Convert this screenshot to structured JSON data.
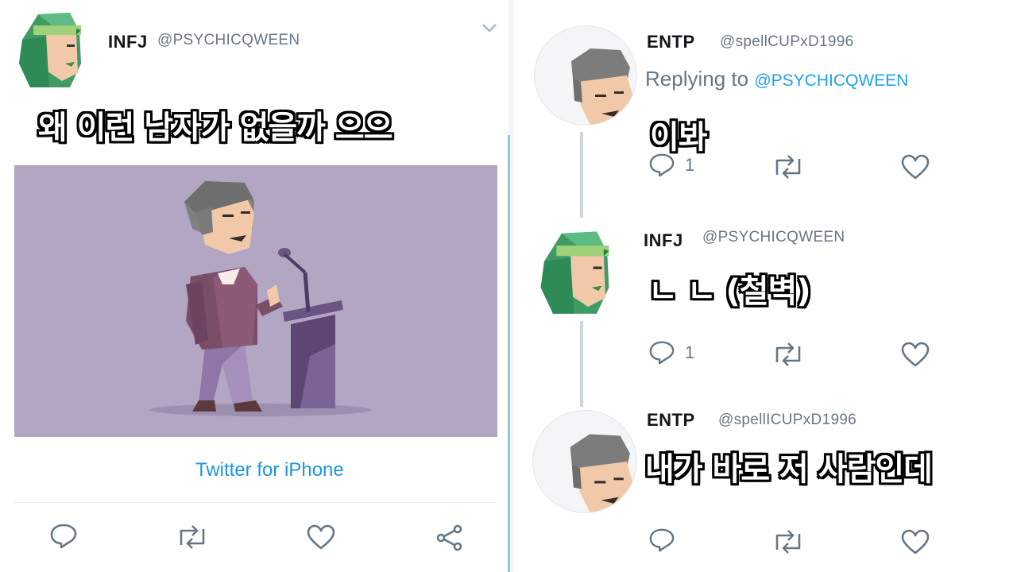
{
  "left_tweet": {
    "name": "INFJ",
    "handle": "@PSYCHICQWEEN",
    "caption": "왜 이런 남자가 없을까 으으",
    "source": "Twitter for iPhone"
  },
  "replies": [
    {
      "name": "ENTP",
      "handle": "@spellCUPxD1996",
      "replying_prefix": "Replying to ",
      "replying_to": "@PSYCHICQWEEN",
      "caption": "이봐",
      "reply_count": "1"
    },
    {
      "name": "INFJ",
      "handle": "@PSYCHICQWEEN",
      "caption": "ㄴ ㄴ (철벽)",
      "reply_count": "1"
    },
    {
      "name": "ENTP",
      "handle": "@spellICUPxD1996",
      "caption": "내가 바로 저 사람인데"
    }
  ],
  "icons": [
    "reply-icon",
    "retweet-icon",
    "like-icon",
    "share-icon",
    "chevron-down-icon"
  ],
  "colors": {
    "accent": "#1da1f2",
    "muted": "#657786",
    "media_bg": "#b3a6c3",
    "thread_line": "#8ec6ee"
  }
}
